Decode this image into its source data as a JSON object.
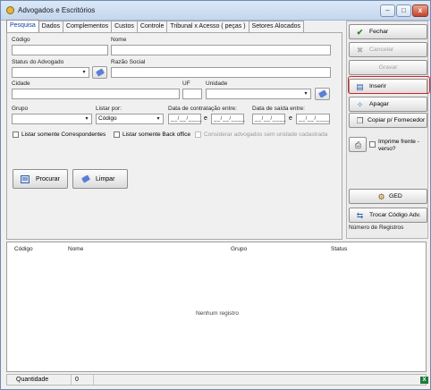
{
  "window": {
    "title": "Advogados e Escritórios",
    "min_glyph": "–",
    "max_glyph": "□",
    "close_glyph": "x"
  },
  "tabs": [
    "Pesquisa",
    "Dados",
    "Complementos",
    "Custos",
    "Controle",
    "Tribunal x Acesso ( peças )",
    "Setores Alocados"
  ],
  "form": {
    "codigo_label": "Código",
    "nome_label": "Nome",
    "status_label": "Status do Advogado",
    "razao_label": "Razão Social",
    "cidade_label": "Cidade",
    "uf_label": "UF",
    "unidade_label": "Unidade",
    "grupo_label": "Grupo",
    "listar_por_label": "Listar por:",
    "listar_por_value": "Código",
    "data_contratacao_label": "Data de contratação entre:",
    "data_saida_label": "Data de saída entre:",
    "date_placeholder": "__/__/____",
    "e_label": "e",
    "chk_correspondentes": "Listar somente Correspondentes",
    "chk_back_office": "Listar somente Back office",
    "chk_sem_unidade": "Considerar advogados sem unidade cadastrada",
    "arrow_glyph": "▾"
  },
  "buttons": {
    "procurar": "Procurar",
    "limpar": "Limpar"
  },
  "sidebar": {
    "fechar": "Fechar",
    "cancelar": "Cancelar",
    "gravar": "Gravar",
    "inserir": "Inserir",
    "apagar": "Apagar",
    "copiar": "Copiar p/ Fornecedor",
    "imprime": "Imprime frente - verso?",
    "ged": "GED",
    "trocar": "Trocar Código Adv.",
    "numero_registros": "Número de Registros"
  },
  "grid": {
    "columns": [
      "Código",
      "Nome",
      "Grupo",
      "Status"
    ],
    "empty_text": "Nenhum registro"
  },
  "statusbar": {
    "quantidade_label": "Quantidade",
    "quantidade_value": "0",
    "excel_glyph": "X"
  },
  "colors": {
    "highlight": "#d3232a",
    "active_tab_text": "#0b3fa6",
    "fechar_check": "#1f8a2e",
    "excel": "#1e7b3a"
  }
}
